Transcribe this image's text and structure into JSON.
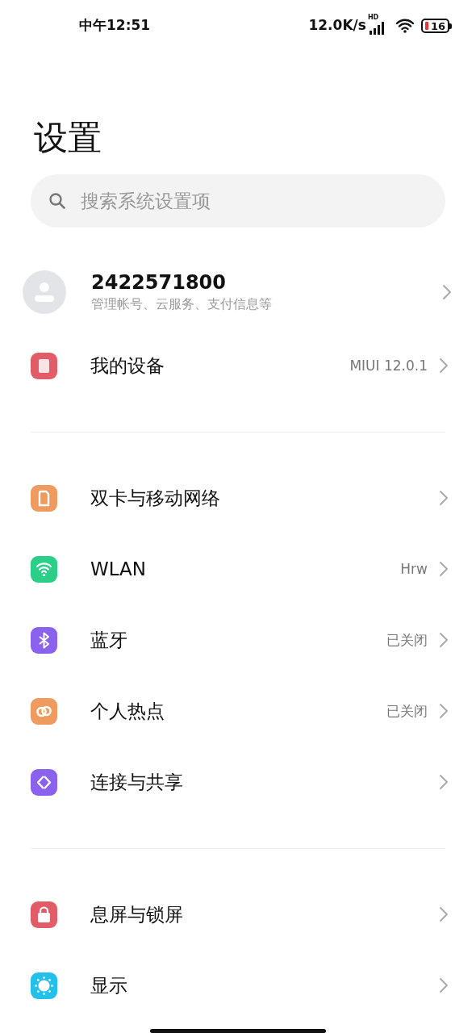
{
  "status_bar": {
    "time": "中午12:51",
    "speed": "12.0K/s",
    "network_badge": "HD",
    "battery": "16"
  },
  "title": "设置",
  "search": {
    "placeholder": "搜索系统设置项"
  },
  "account": {
    "name": "2422571800",
    "subtitle": "管理帐号、云服务、支付信息等"
  },
  "sections": [
    {
      "items": [
        {
          "label": "我的设备",
          "value": "MIUI 12.0.1",
          "color": "#e25c68"
        }
      ]
    },
    {
      "items": [
        {
          "label": "双卡与移动网络",
          "color": "#ef9a5e"
        },
        {
          "label": "WLAN",
          "value": "Hrw",
          "color": "#2ccf88"
        },
        {
          "label": "蓝牙",
          "value": "已关闭",
          "color": "#8a62ee"
        },
        {
          "label": "个人热点",
          "value": "已关闭",
          "color": "#ef9a5e"
        },
        {
          "label": "连接与共享",
          "color": "#8a62ee"
        }
      ]
    },
    {
      "items": [
        {
          "label": "息屏与锁屏",
          "color": "#e25c68"
        },
        {
          "label": "显示",
          "color": "#22c0ea"
        }
      ]
    }
  ]
}
